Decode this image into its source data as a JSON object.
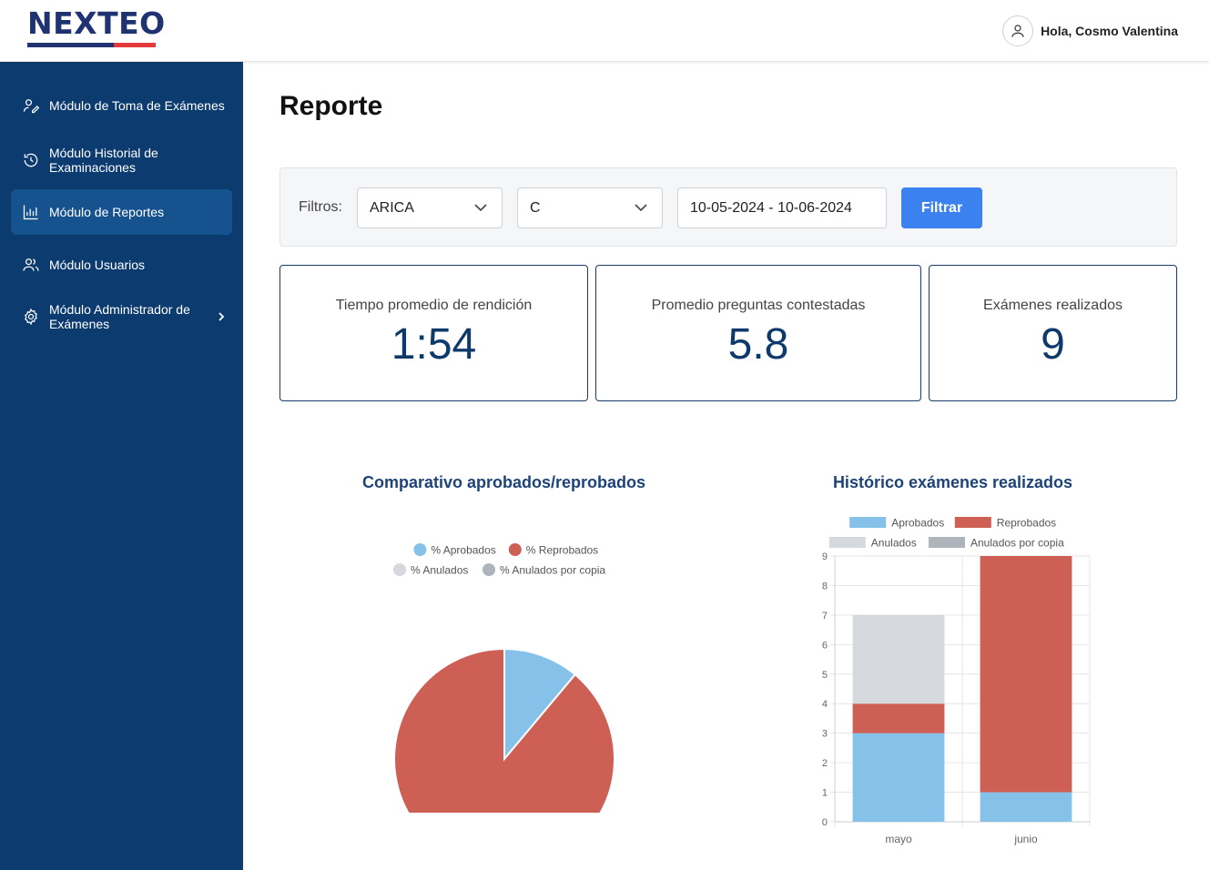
{
  "brand": {
    "name": "NEXTEO",
    "colors": {
      "navy": "#1f3272",
      "red": "#e5393c"
    }
  },
  "header": {
    "greeting": "Hola, Cosmo Valentina",
    "avatar_icon": "user-icon"
  },
  "sidebar": {
    "items": [
      {
        "label": "Módulo de Toma de Exámenes",
        "icon": "exam-taking-icon",
        "active": false
      },
      {
        "label": "Módulo Historial de Examinaciones",
        "icon": "history-icon",
        "active": false
      },
      {
        "label": "Módulo de Reportes",
        "icon": "bar-chart-icon",
        "active": true
      },
      {
        "label": "Módulo Usuarios",
        "icon": "users-icon",
        "active": false
      },
      {
        "label": "Módulo Administrador de Exámenes",
        "icon": "gear-icon",
        "active": false,
        "has_submenu": true
      }
    ]
  },
  "page": {
    "title": "Reporte"
  },
  "filters": {
    "label": "Filtros:",
    "region_value": "ARICA",
    "category_value": "C",
    "date_range": "10-05-2024 - 10-06-2024",
    "submit_label": "Filtrar"
  },
  "stats": [
    {
      "label": "Tiempo promedio de rendición",
      "value": "1:54"
    },
    {
      "label": "Promedio preguntas contestadas",
      "value": "5.8"
    },
    {
      "label": "Exámenes realizados",
      "value": "9"
    }
  ],
  "chart_data": [
    {
      "type": "pie",
      "title": "Comparativo aprobados/reprobados",
      "legend_position": "top",
      "series": [
        {
          "name": "% Aprobados",
          "value": 11.1,
          "color": "#85c1e9"
        },
        {
          "name": "% Reprobados",
          "value": 88.9,
          "color": "#cd5f55"
        },
        {
          "name": "% Anulados",
          "value": 0,
          "color": "#d5d8dc"
        },
        {
          "name": "% Anulados por copia",
          "value": 0,
          "color": "#aeb4bb"
        }
      ]
    },
    {
      "type": "bar",
      "stacked": true,
      "title": "Histórico exámenes realizados",
      "legend_position": "top",
      "categories": [
        "mayo",
        "junio"
      ],
      "ylim": [
        0,
        9
      ],
      "yticks": [
        0,
        1,
        2,
        3,
        4,
        5,
        6,
        7,
        8,
        9
      ],
      "grid": true,
      "series": [
        {
          "name": "Aprobados",
          "values": [
            3,
            1
          ],
          "color": "#85c1e9"
        },
        {
          "name": "Reprobados",
          "values": [
            1,
            8
          ],
          "color": "#cd5f55"
        },
        {
          "name": "Anulados",
          "values": [
            3,
            0
          ],
          "color": "#d5d8dc"
        },
        {
          "name": "Anulados por copia",
          "values": [
            0,
            0
          ],
          "color": "#aeb4bb"
        }
      ]
    }
  ]
}
